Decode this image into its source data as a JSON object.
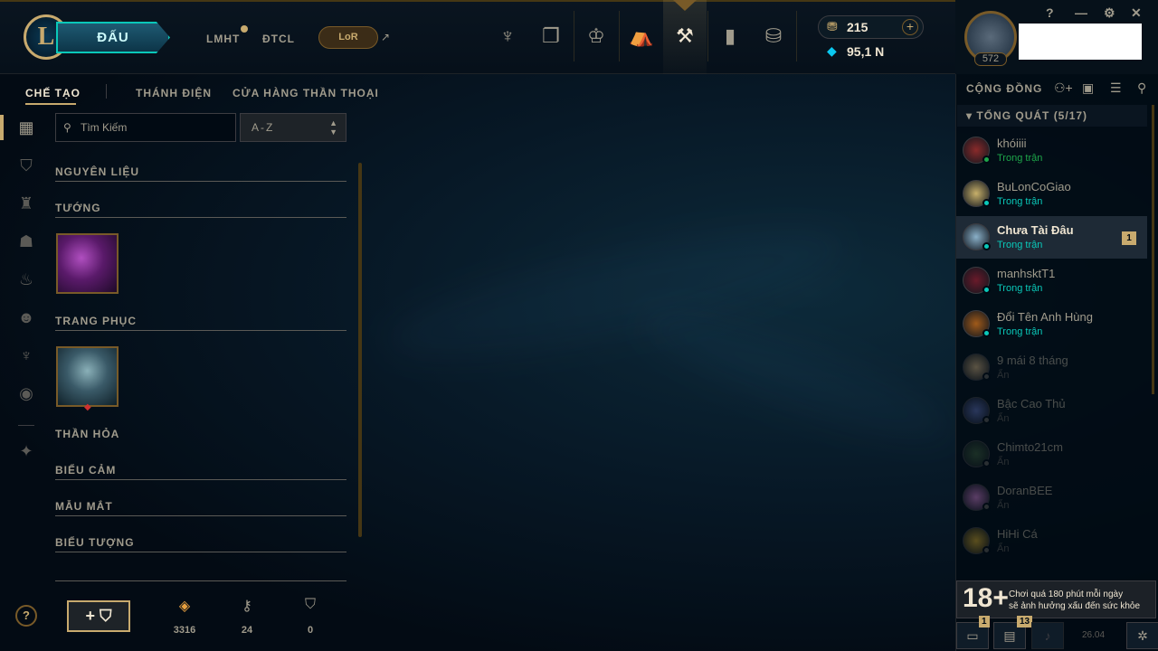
{
  "top": {
    "play_label": "ĐẤU",
    "game_tabs": [
      "LMHT",
      "ĐTCL"
    ],
    "lor_label": "LoR",
    "ext_icon": "↗",
    "logo_letter": "L",
    "nav_icons": [
      "trident-icon",
      "cards-icon",
      "trophy-icon",
      "bag-icon",
      "crafting-icon",
      "clash-icon",
      "store-coins-icon"
    ],
    "rp": "215",
    "be": "95,1 N",
    "level": "572",
    "window_controls": [
      "?",
      "—",
      "⚙",
      "✕"
    ]
  },
  "subtabs": [
    "CHẾ TẠO",
    "THÁNH ĐIỆN",
    "CỬA HÀNG THẦN THOẠI"
  ],
  "search": {
    "placeholder": "Tìm Kiếm",
    "sort": "A-Z"
  },
  "categories": [
    "NGUYÊN LIỆU",
    "TƯỚNG",
    "TRANG PHỤC",
    "THẦN HỎA",
    "BIỂU CẢM",
    "MẪU MẮT",
    "BIỂU TƯỢNG"
  ],
  "resources": [
    {
      "icon": "orange-essence-icon",
      "value": "3316"
    },
    {
      "icon": "key-icon",
      "value": "24"
    },
    {
      "icon": "chest-icon",
      "value": "0"
    }
  ],
  "help_label": "?",
  "add_label": "+ ⛉",
  "social": {
    "title": "CỘNG ĐỒNG",
    "group": "TỔNG QUÁT (5/17)",
    "friends": [
      {
        "name": "khóiiii",
        "status": "Trong trận",
        "status_color": "#1ea64a",
        "avatar": "#8a2a2a"
      },
      {
        "name": "BuLonCoGiao",
        "status": "Trong trận",
        "status_color": "#0ac8b9",
        "avatar": "#c8b06a"
      },
      {
        "name": "Chưa Tài Đâu",
        "status": "Trong trận",
        "status_color": "#0ac8b9",
        "avatar": "#8ab0c8",
        "badge": "1"
      },
      {
        "name": "manhsktT1",
        "status": "Trong trận",
        "status_color": "#0ac8b9",
        "avatar": "#6a1a2a"
      },
      {
        "name": "Đổi Tên Anh Hùng",
        "status": "Trong trận",
        "status_color": "#0ac8b9",
        "avatar": "#a05a1a"
      },
      {
        "name": "9 mái 8 tháng",
        "status": "Ẩn",
        "status_color": "#5b5a56",
        "avatar": "#c8a87a"
      },
      {
        "name": "Bậc Cao Thủ",
        "status": "Ẩn",
        "status_color": "#5b5a56",
        "avatar": "#5a6ab0"
      },
      {
        "name": "Chimto21cm",
        "status": "Ẩn",
        "status_color": "#5b5a56",
        "avatar": "#3a5a3a"
      },
      {
        "name": "DoranBEE",
        "status": "Ẩn",
        "status_color": "#5b5a56",
        "avatar": "#c87ac8"
      },
      {
        "name": "HiHi Cá",
        "status": "Ẩn",
        "status_color": "#5b5a56",
        "avatar": "#c8a02a"
      }
    ],
    "age_rating": "18+",
    "age_warning_1": "Chơi quá 180 phút mỗi ngày",
    "age_warning_2": "sẽ ảnh hưởng xấu đến sức khỏe",
    "chat_badge": "1",
    "notif_badge": "13",
    "version": "26.04"
  }
}
